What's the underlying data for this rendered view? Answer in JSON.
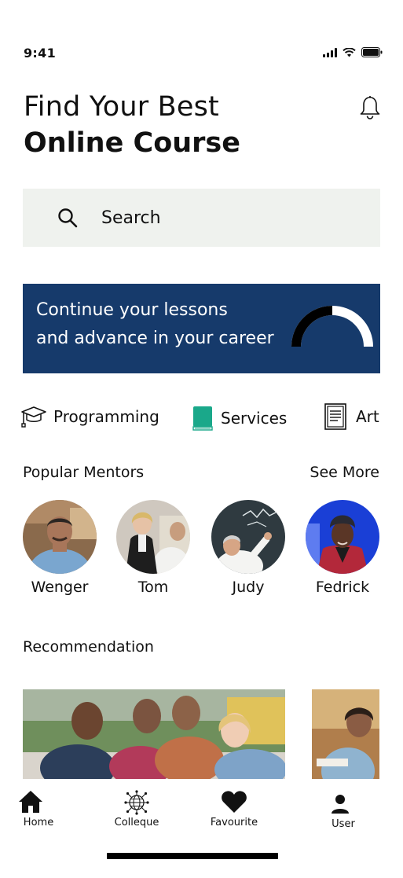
{
  "status_bar": {
    "time": "9:41"
  },
  "header": {
    "title_line1": "Find Your Best",
    "title_line2": "Online Course"
  },
  "search": {
    "placeholder": "Search"
  },
  "banner": {
    "line1": "Continue your lessons",
    "line2": "and advance in your career",
    "progress": 0.5
  },
  "categories": [
    {
      "label": "Programming",
      "icon": "graduation-cap-icon"
    },
    {
      "label": "Services",
      "icon": "book-icon"
    },
    {
      "label": "Art",
      "icon": "document-icon"
    }
  ],
  "mentors": {
    "title": "Popular Mentors",
    "see_more": "See More",
    "items": [
      {
        "name": "Wenger"
      },
      {
        "name": "Tom"
      },
      {
        "name": "Judy"
      },
      {
        "name": "Fedrick"
      }
    ]
  },
  "recommendation": {
    "title": "Recommendation"
  },
  "nav": {
    "items": [
      {
        "label": "Home",
        "icon": "home-icon"
      },
      {
        "label": "Colleque",
        "icon": "globe-network-icon"
      },
      {
        "label": "Favourite",
        "icon": "heart-icon"
      },
      {
        "label": "User",
        "icon": "user-icon"
      }
    ]
  },
  "colors": {
    "banner": "#163a6b",
    "search_bg": "#eff2ee",
    "book": "#1aa88a"
  }
}
